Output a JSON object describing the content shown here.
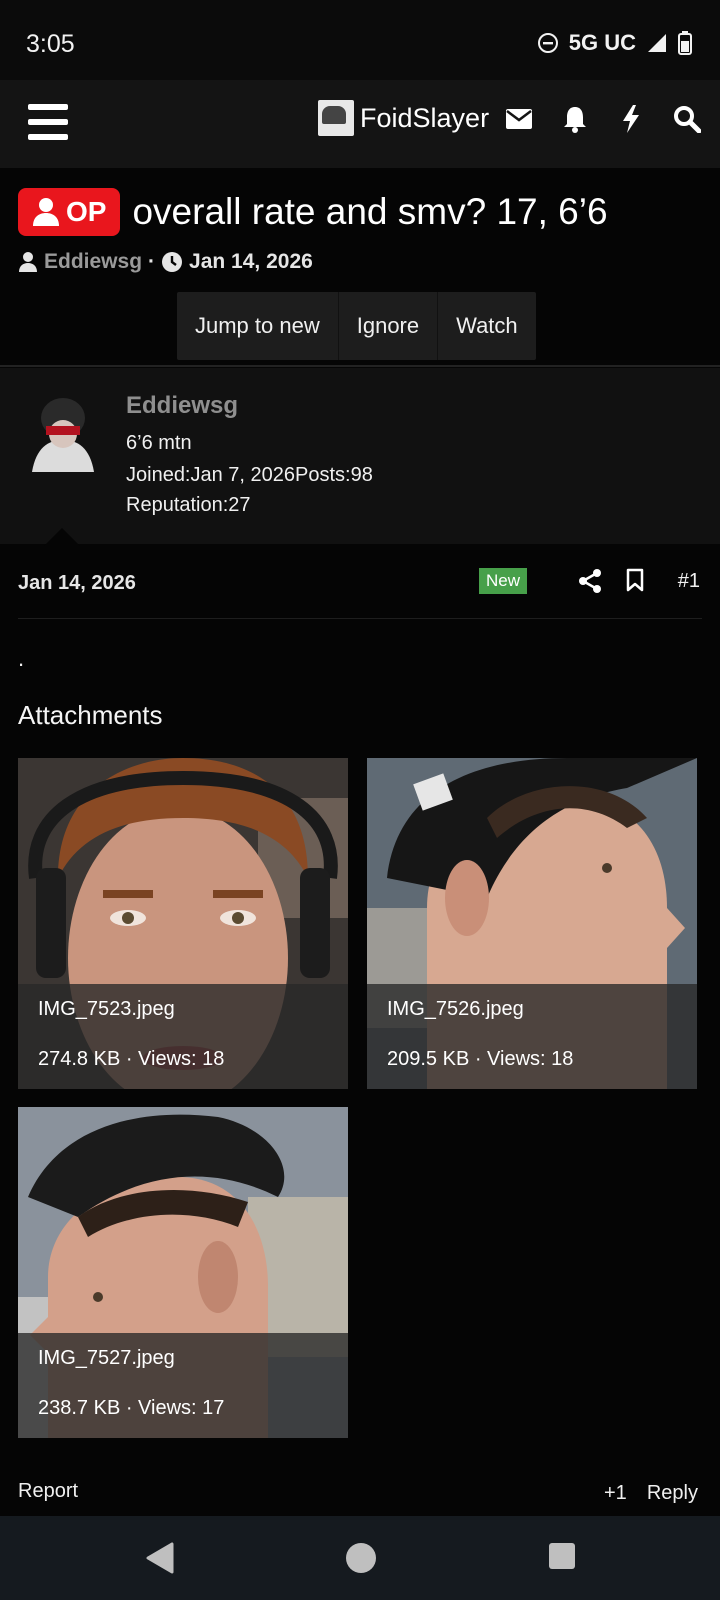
{
  "status_bar": {
    "time": "3:05",
    "network": "5G UC"
  },
  "header": {
    "brand_name": "FoidSlayer",
    "icons": [
      "menu-icon",
      "envelope-icon",
      "bell-icon",
      "bolt-icon",
      "search-icon"
    ]
  },
  "thread": {
    "op_label": "OP",
    "title": "overall rate and smv? 17, 6’6",
    "author": "Eddiewsg",
    "separator": "·",
    "date": "Jan 14, 2026",
    "actions": {
      "jump_to_new": "Jump to new",
      "ignore": "Ignore",
      "watch": "Watch"
    }
  },
  "user_panel": {
    "username": "Eddiewsg",
    "user_title": "6’6 mtn",
    "joined_label": "Joined:",
    "joined_value": "Jan 7, 2026",
    "posts_label": "Posts:",
    "posts_value": "98",
    "reputation_label": "Reputation:",
    "reputation_value": "27"
  },
  "post": {
    "date": "Jan 14, 2026",
    "new_badge": "New",
    "number": "#1",
    "body": ".",
    "attachments_heading": "Attachments",
    "attachments": [
      {
        "filename": "IMG_7523.jpeg",
        "meta": "274.8 KB · Views: 18"
      },
      {
        "filename": "IMG_7526.jpeg",
        "meta": "209.5 KB · Views: 18"
      },
      {
        "filename": "IMG_7527.jpeg",
        "meta": "238.7 KB · Views: 17"
      }
    ],
    "footer": {
      "report": "Report",
      "plus_one": "+1",
      "reply": "Reply"
    }
  },
  "colors": {
    "op_badge": "#e9161d",
    "new_badge": "#47a04a",
    "username_gray": "#8f8f8f",
    "header_bg": "#141414",
    "page_bg": "#050505"
  }
}
